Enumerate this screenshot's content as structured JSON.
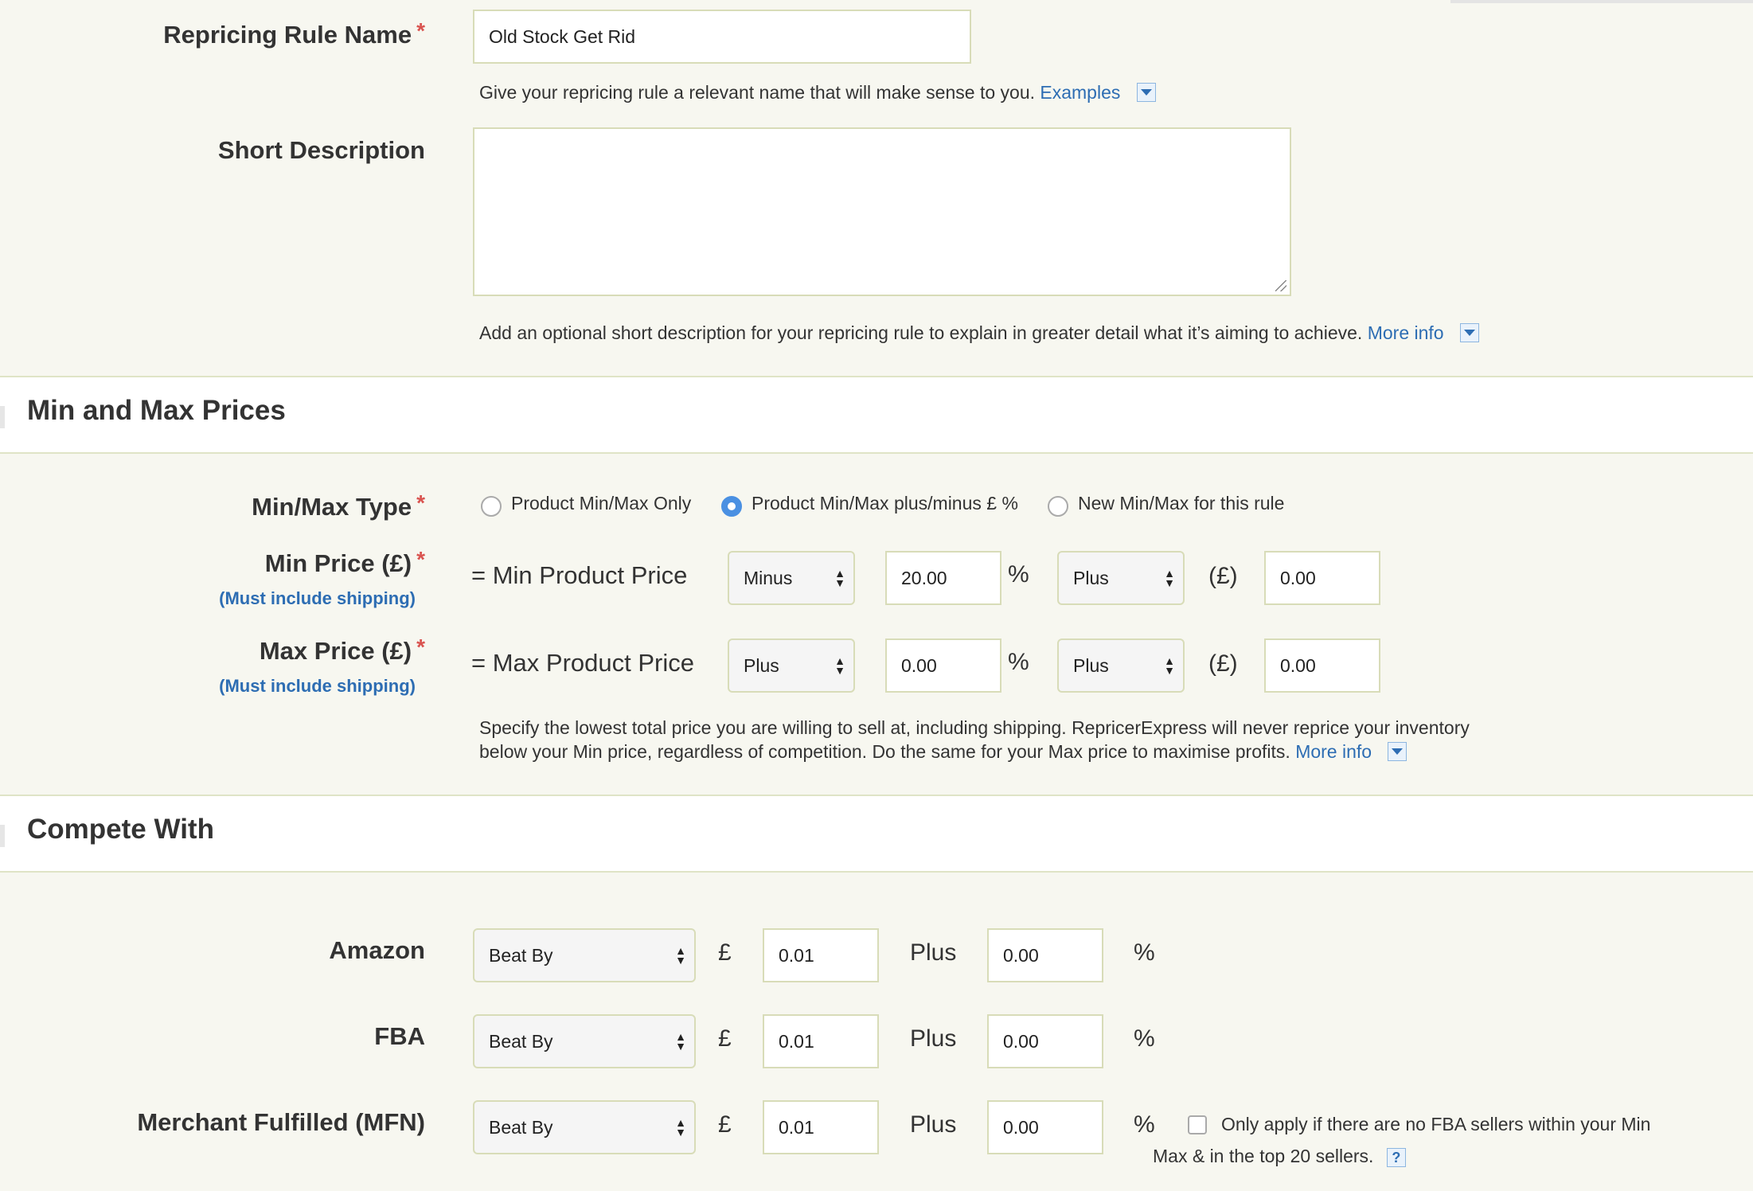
{
  "rule_name": {
    "label": "Repricing Rule Name",
    "required": "*",
    "value": "Old Stock Get Rid",
    "help": "Give your repricing rule a relevant name that will make sense to you.",
    "help_link": "Examples"
  },
  "short_description": {
    "label": "Short Description",
    "value": "",
    "help": "Add an optional short description for your repricing rule to explain in greater detail what it’s aiming to achieve.",
    "help_link": "More info"
  },
  "min_max_section": {
    "title": "Min and Max Prices",
    "type_label": "Min/Max Type",
    "required": "*",
    "options": [
      {
        "label": "Product Min/Max Only",
        "selected": false
      },
      {
        "label": "Product Min/Max plus/minus £ %",
        "selected": true
      },
      {
        "label": "New Min/Max for this rule",
        "selected": false
      }
    ],
    "min_price": {
      "label": "Min Price  (£)",
      "required": "*",
      "note": "(Must include shipping)",
      "eq": "= Min Product Price",
      "op1": "Minus",
      "val1": "20.00",
      "pct": "%",
      "op2": "Plus",
      "cur": "(£)",
      "val2": "0.00"
    },
    "max_price": {
      "label": "Max Price  (£)",
      "required": "*",
      "note": "(Must include shipping)",
      "eq": "= Max Product Price",
      "op1": "Plus",
      "val1": "0.00",
      "pct": "%",
      "op2": "Plus",
      "cur": "(£)",
      "val2": "0.00"
    },
    "help_line1": "Specify the lowest total price you are willing to sell at, including shipping. RepricerExpress will never reprice your inventory",
    "help_line2": "below your Min price, regardless of competition. Do the same for your Max price to maximise profits.",
    "help_link": "More info"
  },
  "compete_section": {
    "title": "Compete With",
    "rows": [
      {
        "label": "Amazon",
        "mode": "Beat By",
        "currency": "£",
        "amount": "0.01",
        "plus": "Plus",
        "percent": "0.00",
        "pct": "%"
      },
      {
        "label": "FBA",
        "mode": "Beat By",
        "currency": "£",
        "amount": "0.01",
        "plus": "Plus",
        "percent": "0.00",
        "pct": "%"
      },
      {
        "label": "Merchant Fulfilled (MFN)",
        "mode": "Beat By",
        "currency": "£",
        "amount": "0.01",
        "plus": "Plus",
        "percent": "0.00",
        "pct": "%"
      }
    ],
    "mfn_option_line1": "Only apply if there are no FBA sellers within your Min",
    "mfn_option_line2": "Max & in the top 20 sellers.",
    "help_icon": "?"
  }
}
